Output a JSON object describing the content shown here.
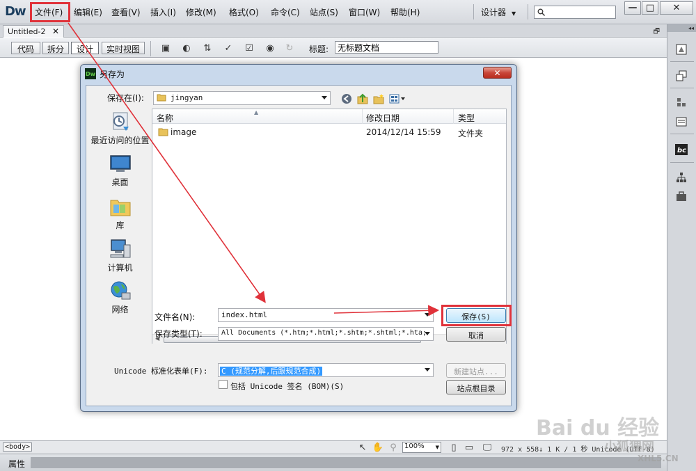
{
  "app": {
    "logo": "Dw",
    "menu": [
      "文件(F)",
      "编辑(E)",
      "查看(V)",
      "插入(I)",
      "修改(M)",
      "格式(O)",
      "命令(C)",
      "站点(S)",
      "窗口(W)",
      "帮助(H)"
    ],
    "workspace": "设计器",
    "window_controls": [
      "—",
      "□",
      "✕"
    ]
  },
  "document": {
    "tab_title": "Untitled-2",
    "tab_close": "✕",
    "views": [
      "代码",
      "拆分",
      "设计",
      "实时视图"
    ],
    "active_view": "设计",
    "title_label": "标题:",
    "title_value": "无标题文档"
  },
  "status": {
    "tag": "<body>",
    "zoom": "100%",
    "info": "972 x 558↓ 1 K / 1 秒 Unicode (UTF-8)"
  },
  "properties": {
    "label": "属性"
  },
  "dialog": {
    "icon": "Dw",
    "title": "另存为",
    "close": "✕",
    "save_in_label": "保存在(I):",
    "save_in_value": "jingyan",
    "places": [
      "最近访问的位置",
      "桌面",
      "库",
      "计算机",
      "网络"
    ],
    "columns": [
      "名称",
      "修改日期",
      "类型"
    ],
    "files": [
      {
        "name": "image",
        "modified": "2014/12/14 15:59",
        "type": "文件夹"
      }
    ],
    "filename_label": "文件名(N):",
    "filename_value": "index.html",
    "filetype_label": "保存类型(T):",
    "filetype_value": "All Documents (*.htm;*.html;*.shtm;*.shtml;*.hta;",
    "unicode_label": "Unicode 标准化表单(F):",
    "unicode_value": "C (规范分解,后跟规范合成)",
    "bom_label": "包括 Unicode 签名 (BOM)(S)",
    "save_button": "保存(S)",
    "cancel_button": "取消",
    "new_site_button": "新建站点...",
    "site_root_button": "站点根目录"
  },
  "watermarks": {
    "baidu": "Bai du 经验",
    "fox": "小狐狸网",
    "url": "XHL5.CN"
  },
  "colors": {
    "highlight": "#e0323a",
    "selection": "#3399ff",
    "dialog_frame": "#c9d9ec"
  }
}
